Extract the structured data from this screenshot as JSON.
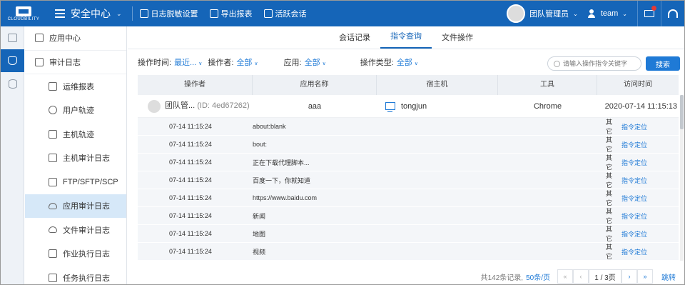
{
  "brand": {
    "logo_text": "CLOUDBILITY"
  },
  "header": {
    "app_title": "安全中心",
    "buttons": [
      "日志脱敏设置",
      "导出报表",
      "活跃会话"
    ],
    "user": "团队管理员",
    "team": "team"
  },
  "sidebar": {
    "items": [
      {
        "label": "应用中心",
        "level": "top",
        "icon": "app-center-icon"
      },
      {
        "label": "审计日志",
        "level": "top",
        "icon": "audit-log-icon"
      },
      {
        "label": "运维报表",
        "level": "sub",
        "icon": "report-icon"
      },
      {
        "label": "用户轨迹",
        "level": "sub",
        "icon": "user-track-icon"
      },
      {
        "label": "主机轨迹",
        "level": "sub",
        "icon": "host-track-icon"
      },
      {
        "label": "主机审计日志",
        "level": "sub",
        "icon": "monitor-icon"
      },
      {
        "label": "FTP/SFTP/SCP",
        "level": "sub",
        "icon": "ftp-icon"
      },
      {
        "label": "应用审计日志",
        "level": "sub",
        "icon": "cloud-icon",
        "active": true
      },
      {
        "label": "文件审计日志",
        "level": "sub",
        "icon": "file-cloud-icon"
      },
      {
        "label": "作业执行日志",
        "level": "sub",
        "icon": "job-icon"
      },
      {
        "label": "任务执行日志",
        "level": "sub",
        "icon": "task-icon"
      }
    ]
  },
  "tabs": [
    {
      "label": "会话记录",
      "active": false
    },
    {
      "label": "指令查询",
      "active": true
    },
    {
      "label": "文件操作",
      "active": false
    }
  ],
  "filters": {
    "time_label": "操作时间:",
    "time_value": "最近...",
    "operator_label": "操作者:",
    "operator_value": "全部",
    "app_label": "应用:",
    "app_value": "全部",
    "type_label": "操作类型:",
    "type_value": "全部",
    "search_placeholder": "请输入操作指令关键字",
    "search_button": "搜索"
  },
  "table": {
    "columns": [
      "操作者",
      "应用名称",
      "宿主机",
      "工具",
      "访问时间"
    ],
    "session": {
      "operator": "团队管...",
      "operator_id": "(ID: 4ed67262)",
      "app": "aaa",
      "host": "tongjun",
      "tool": "Chrome",
      "time": "2020-07-14  11:15:13"
    },
    "commands": [
      {
        "time": "07-14 11:15:24",
        "cmd": "about:blank",
        "type": "其它",
        "action": "指令定位"
      },
      {
        "time": "07-14 11:15:24",
        "cmd": "bout:",
        "type": "其它",
        "action": "指令定位"
      },
      {
        "time": "07-14 11:15:24",
        "cmd": "正在下载代理脚本...",
        "type": "其它",
        "action": "指令定位"
      },
      {
        "time": "07-14 11:15:24",
        "cmd": "百度一下，你就知道",
        "type": "其它",
        "action": "指令定位"
      },
      {
        "time": "07-14 11:15:24",
        "cmd": "https://www.baidu.com",
        "type": "其它",
        "action": "指令定位"
      },
      {
        "time": "07-14 11:15:24",
        "cmd": "新闻",
        "type": "其它",
        "action": "指令定位"
      },
      {
        "time": "07-14 11:15:24",
        "cmd": "地图",
        "type": "其它",
        "action": "指令定位"
      },
      {
        "time": "07-14 11:15:24",
        "cmd": "视频",
        "type": "其它",
        "action": "指令定位"
      }
    ]
  },
  "pagination": {
    "total": "共142条记录,",
    "page_size": "50条/页",
    "first": "«",
    "prev": "‹",
    "page": "1 / 3页",
    "next": "›",
    "last": "»",
    "jump": "跳转"
  }
}
